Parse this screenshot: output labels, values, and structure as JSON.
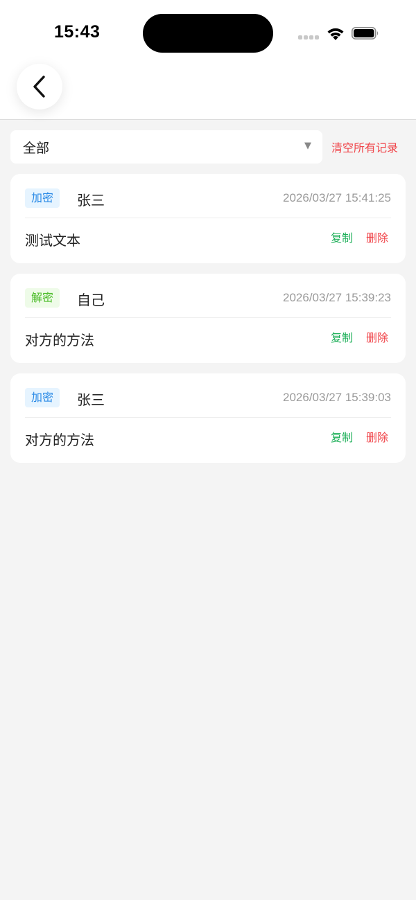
{
  "status_bar": {
    "time": "15:43"
  },
  "filter": {
    "selected": "全部",
    "clear_all_label": "清空所有记录"
  },
  "records": [
    {
      "type": "加密",
      "type_kind": "enc",
      "name": "张三",
      "time": "2026/03/27 15:41:25",
      "content": "测试文本",
      "copy_label": "复制",
      "delete_label": "删除"
    },
    {
      "type": "解密",
      "type_kind": "dec",
      "name": "自己",
      "time": "2026/03/27 15:39:23",
      "content": "对方的方法",
      "copy_label": "复制",
      "delete_label": "删除"
    },
    {
      "type": "加密",
      "type_kind": "enc",
      "name": "张三",
      "time": "2026/03/27 15:39:03",
      "content": "对方的方法",
      "copy_label": "复制",
      "delete_label": "删除"
    }
  ],
  "colors": {
    "encrypt_badge": "#2a8ae6",
    "decrypt_badge": "#4cbc2a",
    "copy": "#1fb05a",
    "delete": "#f0454a"
  }
}
